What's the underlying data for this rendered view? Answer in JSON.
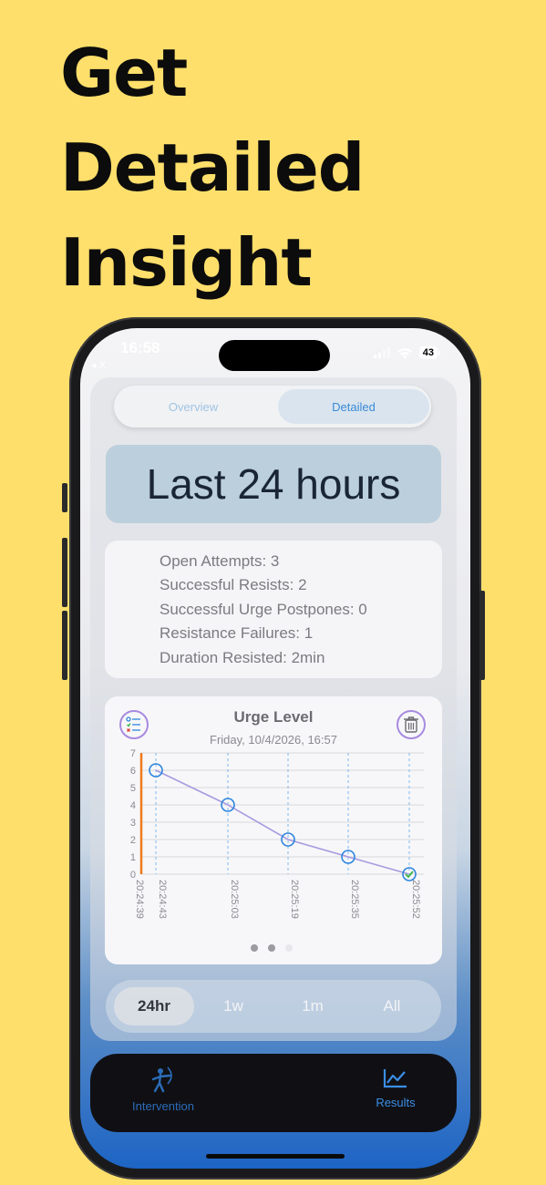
{
  "headline": {
    "line1": "Get",
    "line2": "Detailed",
    "line3": "Insight"
  },
  "status": {
    "time": "16:58",
    "back": "◂ X",
    "battery": "43"
  },
  "segment": {
    "overview": "Overview",
    "detailed": "Detailed",
    "selected": "Detailed"
  },
  "range_title": "Last 24 hours",
  "stats": {
    "open_attempts": "Open Attempts: 3",
    "successful_resists": "Successful Resists: 2",
    "urge_postpones": "Successful Urge Postpones: 0",
    "resistance_failures": "Resistance Failures: 1",
    "duration_resisted": "Duration Resisted: 2min"
  },
  "chart_card": {
    "title": "Urge Level",
    "date": "Friday, 10/4/2026, 16:57",
    "page_count": 3,
    "active_page": 2
  },
  "chart_data": {
    "type": "line",
    "title": "Urge Level",
    "subtitle": "Friday, 10/4/2026, 16:57",
    "x": [
      "20:24:43",
      "20:25:03",
      "20:25:19",
      "20:25:35",
      "20:25:52"
    ],
    "x_start_label": "20:24:39",
    "values": [
      6,
      4,
      2,
      1,
      0
    ],
    "ylim": [
      0,
      7
    ],
    "yticks": [
      0,
      1,
      2,
      3,
      4,
      5,
      6,
      7
    ],
    "grid": true,
    "line_color": "#a79be0",
    "marker_color": "#2e86de",
    "start_marker_color": "#f07a1a",
    "last_point_checked": true
  },
  "period": {
    "options": [
      "24hr",
      "1w",
      "1m",
      "All"
    ],
    "selected": "24hr"
  },
  "tabbar": {
    "intervention": "Intervention",
    "results": "Results",
    "selected": "Results"
  },
  "colors": {
    "background": "#fedf6b",
    "accent": "#3b8ee6"
  }
}
